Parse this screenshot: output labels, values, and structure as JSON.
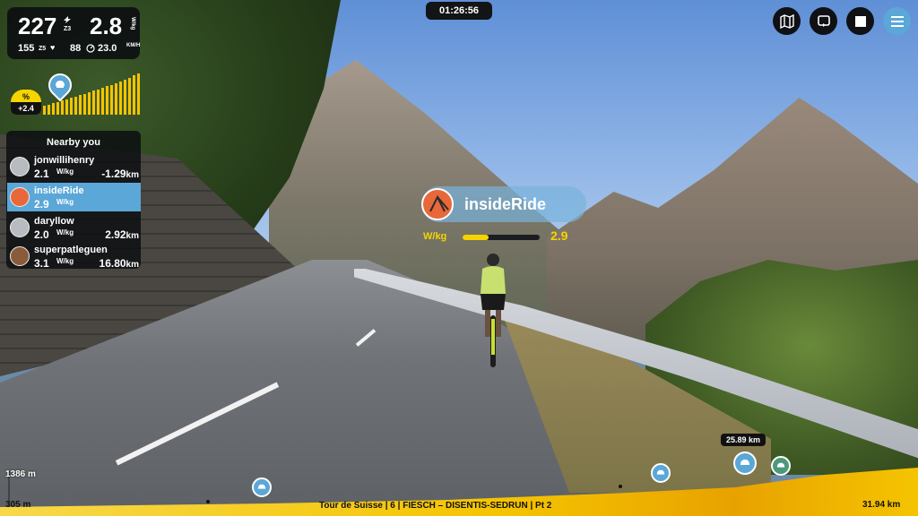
{
  "stats": {
    "power": "227",
    "zone": "Z3",
    "wkg": "2.8",
    "wkg_unit": "W/kg",
    "heart_rate": "155",
    "hr_zone": "Z5",
    "cadence": "88",
    "speed": "23.0",
    "speed_unit": "KM/H"
  },
  "elevation": {
    "unit_symbol": "%",
    "grade": "+2.4"
  },
  "nearby": {
    "title": "Nearby you",
    "riders": [
      {
        "name": "jonwillihenry",
        "wkg": "2.1",
        "unit": "W/kg",
        "distance": "-1.29",
        "dist_unit": "km"
      },
      {
        "name": "insideRide",
        "wkg": "2.9",
        "unit": "W/kg",
        "distance": "",
        "dist_unit": ""
      },
      {
        "name": "daryllow",
        "wkg": "2.0",
        "unit": "W/kg",
        "distance": "2.92",
        "dist_unit": "km"
      },
      {
        "name": "superpatleguen",
        "wkg": "3.1",
        "unit": "W/kg",
        "distance": "16.80",
        "dist_unit": "km"
      }
    ]
  },
  "timer": "01:26:56",
  "controls": {
    "icons": [
      "map-icon",
      "repeat-icon",
      "stop-icon",
      "menu-icon"
    ]
  },
  "rider_tag": {
    "name": "insideRide",
    "label": "W/kg",
    "value": "2.9",
    "fill": 0.34
  },
  "route": {
    "max_elevation": "1386 m",
    "min_elevation": "305 m",
    "title": "Tour de Suisse | 6 | FIESCH – DISENTIS-SEDRUN | Pt 2",
    "total_distance": "31.94 km",
    "marker_distance": "25.89 km"
  },
  "colors": {
    "accent": "#5aa7d8",
    "highlight": "#f5d400",
    "panel": "#0c0e12"
  }
}
